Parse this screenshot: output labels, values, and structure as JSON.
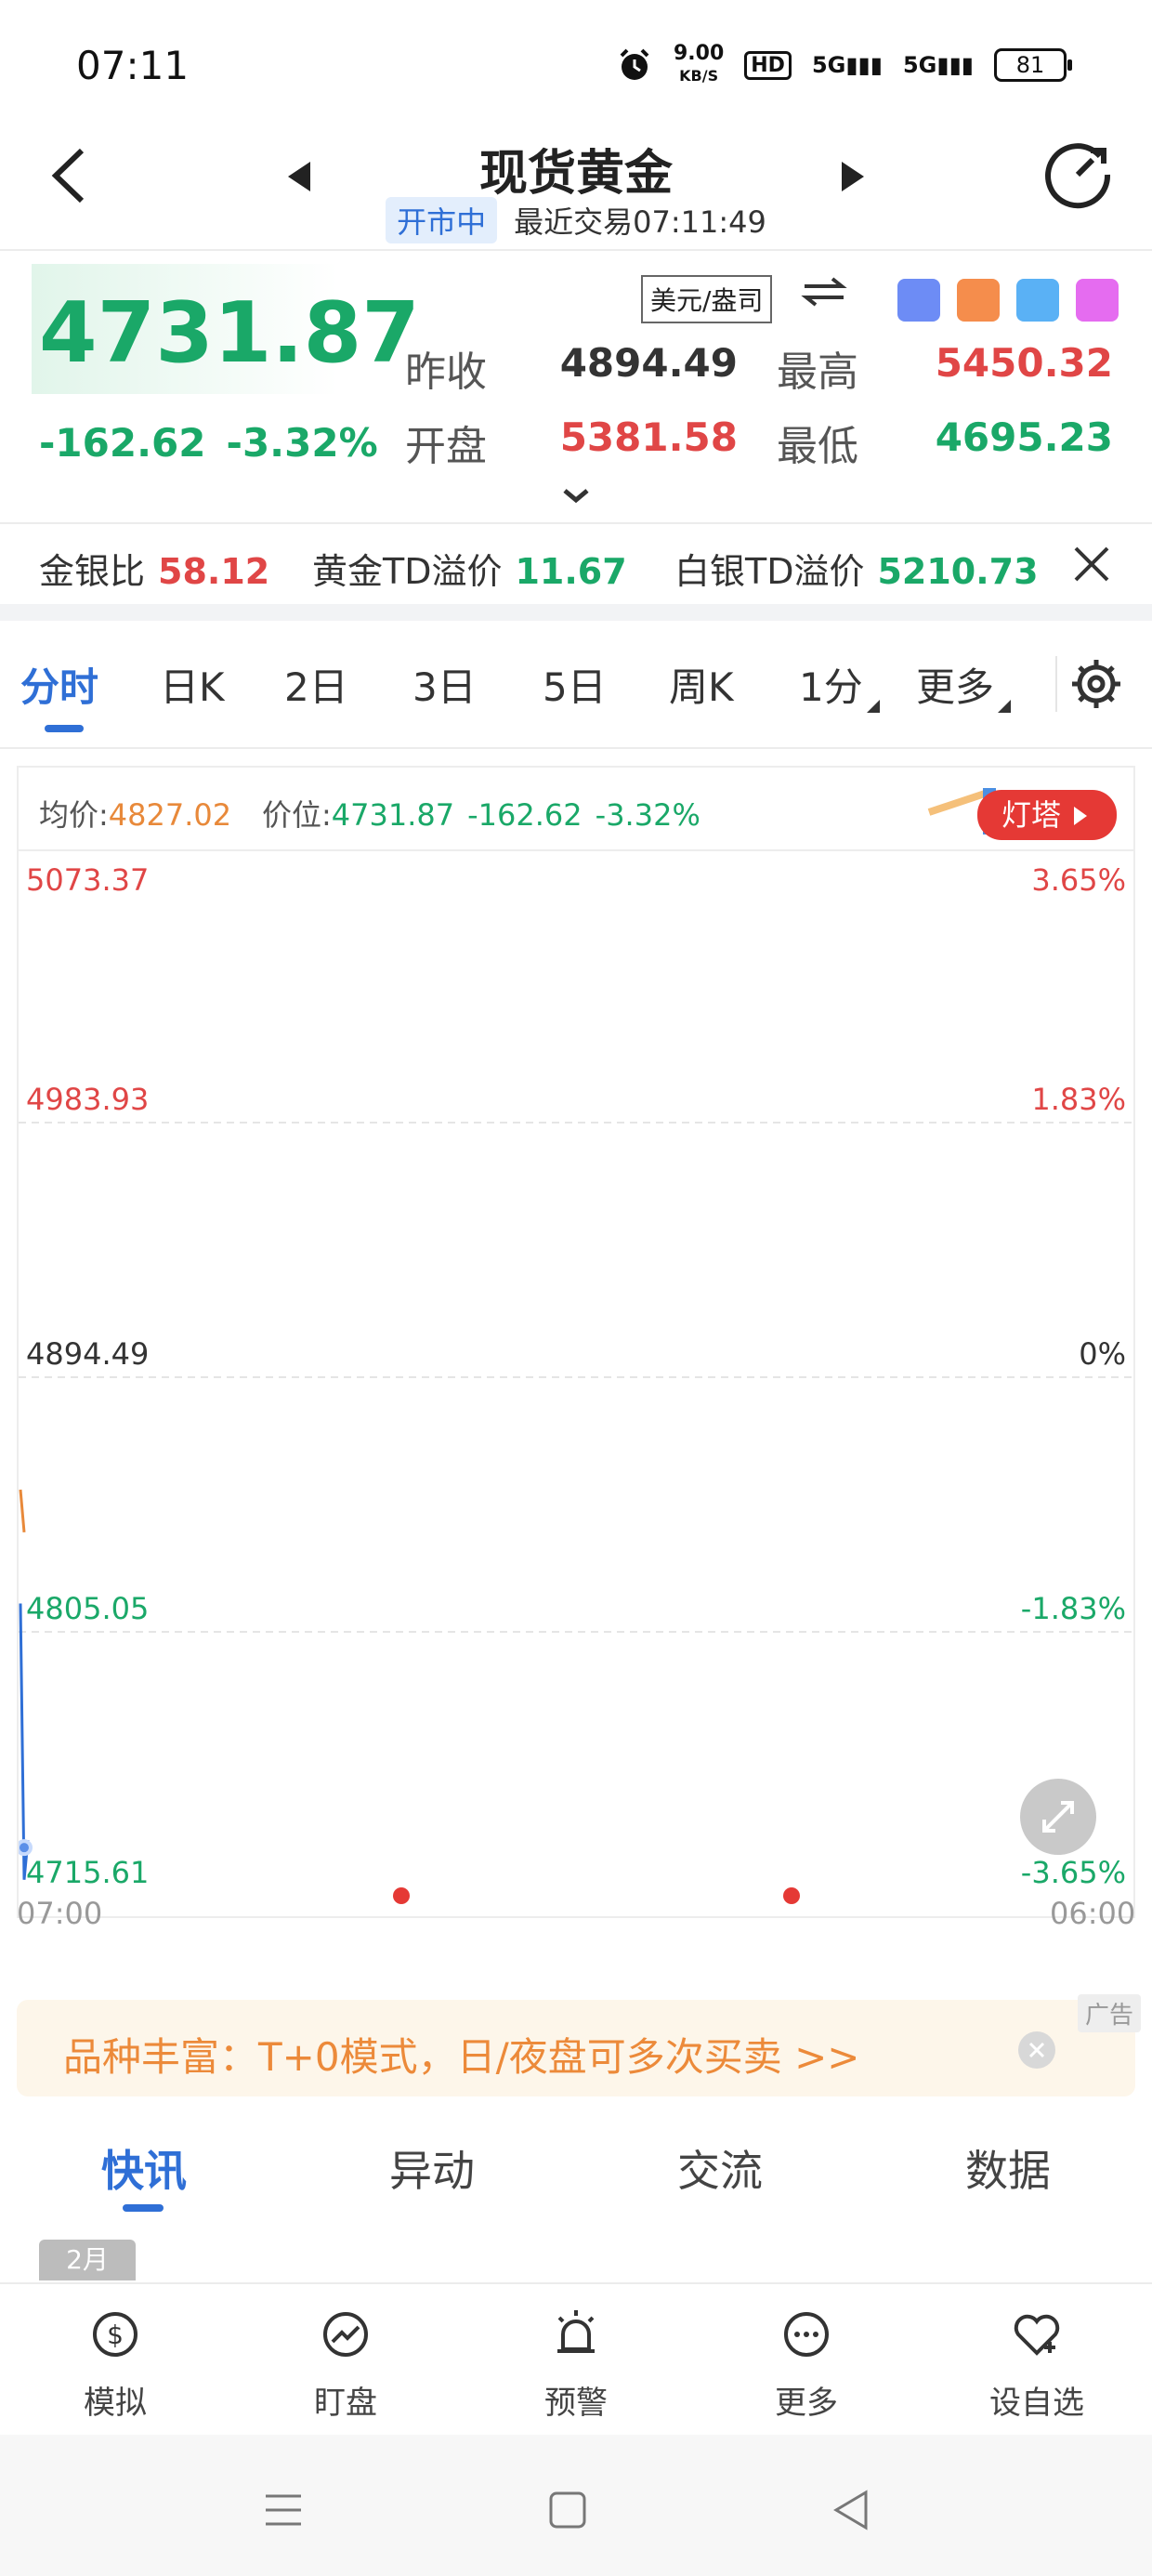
{
  "status_bar": {
    "time": "07:11",
    "net_speed_value": "9.00",
    "net_speed_unit": "KB/S",
    "hd": "HD",
    "sig1": "5G",
    "sig2": "5G",
    "battery": "81"
  },
  "header": {
    "title": "现货黄金",
    "market_status": "开市中",
    "last_trade": "最近交易07:11:49"
  },
  "quote": {
    "price": "4731.87",
    "change": "-162.62",
    "change_pct": "-3.32%",
    "unit": "美元/盎司",
    "prev_close_label": "昨收",
    "prev_close": "4894.49",
    "high_label": "最高",
    "high": "5450.32",
    "open_label": "开盘",
    "open": "5381.58",
    "low_label": "最低",
    "low": "4695.23"
  },
  "ratios": [
    {
      "label": "金银比",
      "value": "58.12"
    },
    {
      "label": "黄金TD溢价",
      "value": "11.67"
    },
    {
      "label": "白银TD溢价",
      "value": "5210.73"
    }
  ],
  "period_tabs": [
    "分时",
    "日K",
    "2日",
    "3日",
    "5日",
    "周K",
    "1分",
    "更多"
  ],
  "chart_info": {
    "avg_label": "均价:",
    "avg": "4827.02",
    "pos_label": "价位:",
    "pos": "4731.87",
    "chg": "-162.62",
    "pct": "-3.32%",
    "lighthouse": "灯塔"
  },
  "chart_data": {
    "type": "line",
    "y_labels_left": [
      "5073.37",
      "4983.93",
      "4894.49",
      "4805.05",
      "4715.61"
    ],
    "y_labels_right": [
      "3.65%",
      "1.83%",
      "0%",
      "-1.83%",
      "-3.65%"
    ],
    "ylim": [
      4715.61,
      5073.37
    ],
    "x_labels": [
      "07:00",
      "06:00"
    ],
    "series": [
      {
        "values": [
          4815,
          4718,
          4731.87
        ],
        "color": "#2f6fd6"
      },
      {
        "values": [
          4855,
          4840
        ],
        "color": "#e8893a"
      }
    ]
  },
  "ad": {
    "text": "品种丰富：T+0模式，日/夜盘可多次买卖 >>",
    "tag": "广告"
  },
  "news_tabs": [
    "快讯",
    "异动",
    "交流",
    "数据"
  ],
  "month_chip": "2月",
  "bottom_nav": [
    {
      "label": "模拟",
      "icon": "simulate-icon"
    },
    {
      "label": "盯盘",
      "icon": "watch-chart-icon"
    },
    {
      "label": "预警",
      "icon": "alarm-icon"
    },
    {
      "label": "更多",
      "icon": "more-icon"
    },
    {
      "label": "设自选",
      "icon": "heart-add-icon"
    }
  ],
  "colors": {
    "up": "#e04646",
    "down": "#1aa868",
    "accent": "#2f6fd6",
    "avg_line": "#e8893a"
  }
}
